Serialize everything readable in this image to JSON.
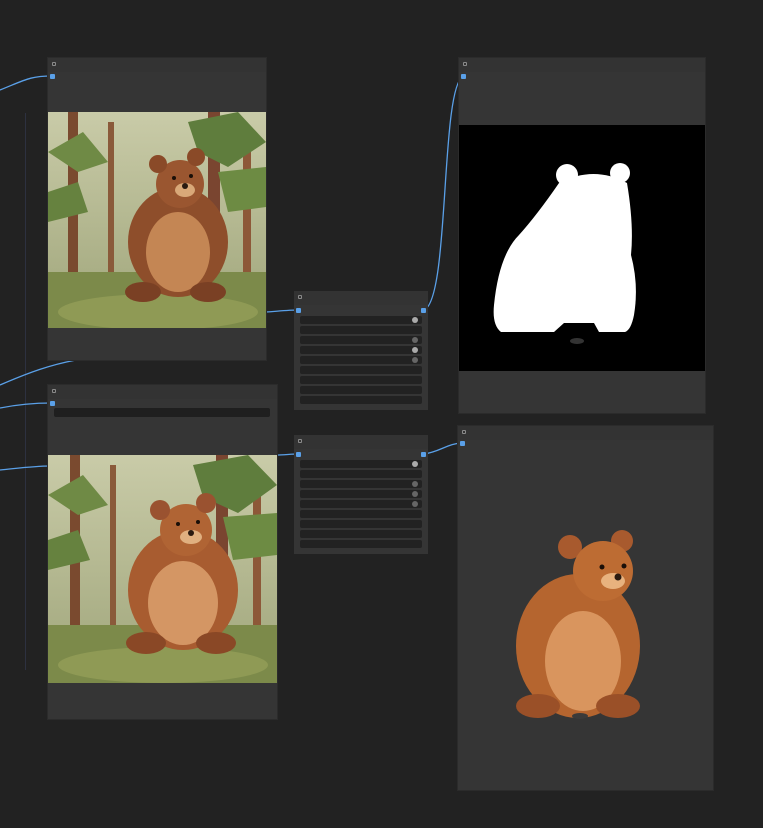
{
  "canvas": {
    "background": "#222222",
    "wire_color": "#5aa0e8"
  },
  "nodes": {
    "load_image_top": {
      "title": "",
      "image": "bear-forest-illustration"
    },
    "load_image_bottom": {
      "title": "",
      "image": "bear-forest-illustration",
      "text_value": ""
    },
    "remove_bg_top": {
      "title": "",
      "rows": 10
    },
    "remove_bg_bottom": {
      "title": "",
      "rows": 10
    },
    "preview_mask": {
      "title": "",
      "image": "bear-silhouette-mask"
    },
    "preview_result": {
      "title": "",
      "image": "bear-transparent-cutout"
    }
  }
}
